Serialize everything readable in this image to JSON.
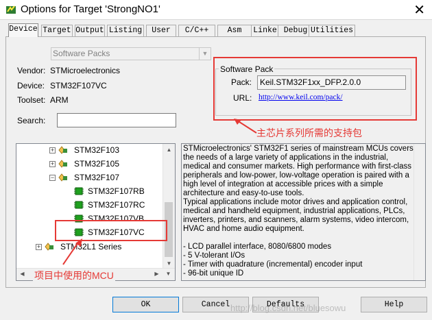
{
  "window": {
    "title": "Options for Target 'StrongNO1'"
  },
  "tabs": [
    {
      "label": "Device"
    },
    {
      "label": "Target"
    },
    {
      "label": "Output"
    },
    {
      "label": "Listing"
    },
    {
      "label": "User"
    },
    {
      "label": "C/C++"
    },
    {
      "label": "Asm"
    },
    {
      "label": "Linker"
    },
    {
      "label": "Debug"
    },
    {
      "label": "Utilities"
    }
  ],
  "device": {
    "pack_select": "Software Packs",
    "vendor_label": "Vendor:",
    "vendor": "STMicroelectronics",
    "device_label": "Device:",
    "device": "STM32F107VC",
    "toolset_label": "Toolset:",
    "toolset": "ARM",
    "search_label": "Search:",
    "search_value": ""
  },
  "software_pack": {
    "group_title": "Software Pack",
    "pack_label": "Pack:",
    "pack_value": "Keil.STM32F1xx_DFP.2.0.0",
    "url_label": "URL:",
    "url": "http://www.keil.com/pack/"
  },
  "tree": {
    "items": [
      {
        "label": "STM32F103"
      },
      {
        "label": "STM32F105"
      },
      {
        "label": "STM32F107"
      },
      {
        "label": "STM32F107RB"
      },
      {
        "label": "STM32F107RC"
      },
      {
        "label": "STM32F107VB"
      },
      {
        "label": "STM32F107VC"
      },
      {
        "label": "STM32L1 Series"
      }
    ]
  },
  "description": {
    "para1": "STMicroelectronics' STM32F1 series of mainstream MCUs covers the needs of a large variety of applications in the industrial, medical and consumer markets. High performance with first-class peripherals and low-power, low-voltage operation is paired with a high level of integration at accessible prices with a simple architecture and easy-to-use tools.",
    "para2": "Typical applications include motor drives and application control, medical and handheld equipment, industrial applications, PLCs, inverters, printers, and scanners, alarm systems, video intercom, HVAC and home audio equipment.",
    "bullets": [
      "- LCD parallel interface, 8080/6800 modes",
      "- 5 V-tolerant I/Os",
      "- Timer with quadrature (incremental) encoder input",
      "- 96-bit unique ID"
    ]
  },
  "annotations": {
    "pack_note": "主芯片系列所需的支持包",
    "mcu_note": "项目中使用的MCU"
  },
  "buttons": {
    "ok": "OK",
    "cancel": "Cancel",
    "defaults": "Defaults",
    "help": "Help"
  },
  "watermark": "http://blog.csdn.net/bluesowu",
  "colors": {
    "annotation_red": "#e53935",
    "link_blue": "#0000ee",
    "chip_green": "#1fa01f"
  }
}
